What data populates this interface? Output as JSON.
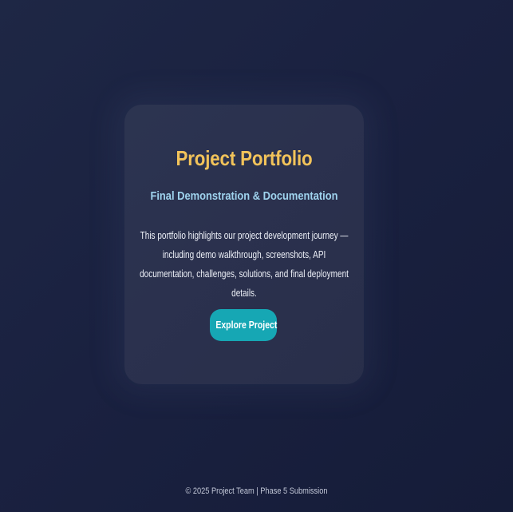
{
  "hero": {
    "title": "Project Portfolio",
    "subtitle": "Final Demonstration & Documentation",
    "description": "This portfolio highlights our project development journey — including demo walkthrough, screenshots, API documentation, challenges, solutions, and final deployment details.",
    "cta_label": "Explore Project"
  },
  "footer": {
    "text": "© 2025 Project Team | Phase 5 Submission"
  },
  "colors": {
    "background": "#1a2140",
    "title": "#f2c35a",
    "subtitle": "#9fd3ee",
    "button": "#16a7b4"
  }
}
